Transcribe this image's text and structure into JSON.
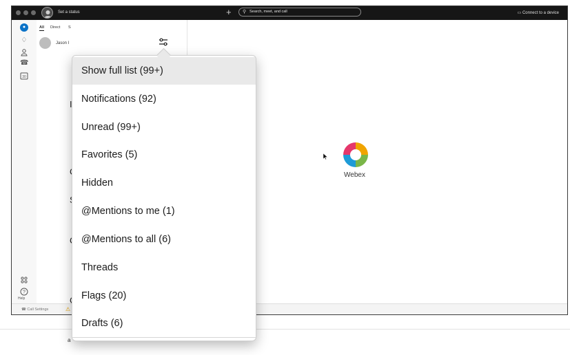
{
  "titlebar": {
    "status": "Set a status",
    "search_placeholder": "Search, meet, and call",
    "connect": "Connect to a device",
    "new_icon": "plus-icon",
    "search_icon": "search-icon",
    "connect_icon": "device-icon"
  },
  "nav": {
    "icons": [
      "chat-icon",
      "notification-icon",
      "contacts-icon",
      "calls-icon",
      "meetings-icon",
      "apps-icon",
      "help-icon"
    ],
    "help_label": "Help"
  },
  "list": {
    "tabs": [
      "All",
      "Direct",
      "S"
    ],
    "row_name": "Jason I",
    "frag1": "I",
    "frag2": "C",
    "frag3": "S",
    "frag4": "C",
    "frag5": "C",
    "filter_icon": "filter-icon"
  },
  "bottom": {
    "call_settings": "Call Settings",
    "warning_icon": "warning-icon"
  },
  "menu": {
    "items": [
      "Show full list (99+)",
      "Notifications (92)",
      "Unread (99+)",
      "Favorites (5)",
      "Hidden",
      "@Mentions to me (1)",
      "@Mentions to all (6)",
      "Threads",
      "Flags (20)",
      "Drafts (6)"
    ],
    "selected_index": 0
  },
  "main": {
    "logo_text": "Webex"
  },
  "colors": {
    "titlebar": "#161616",
    "selected": "#e9e9e9",
    "accent": "#0b72c7"
  }
}
